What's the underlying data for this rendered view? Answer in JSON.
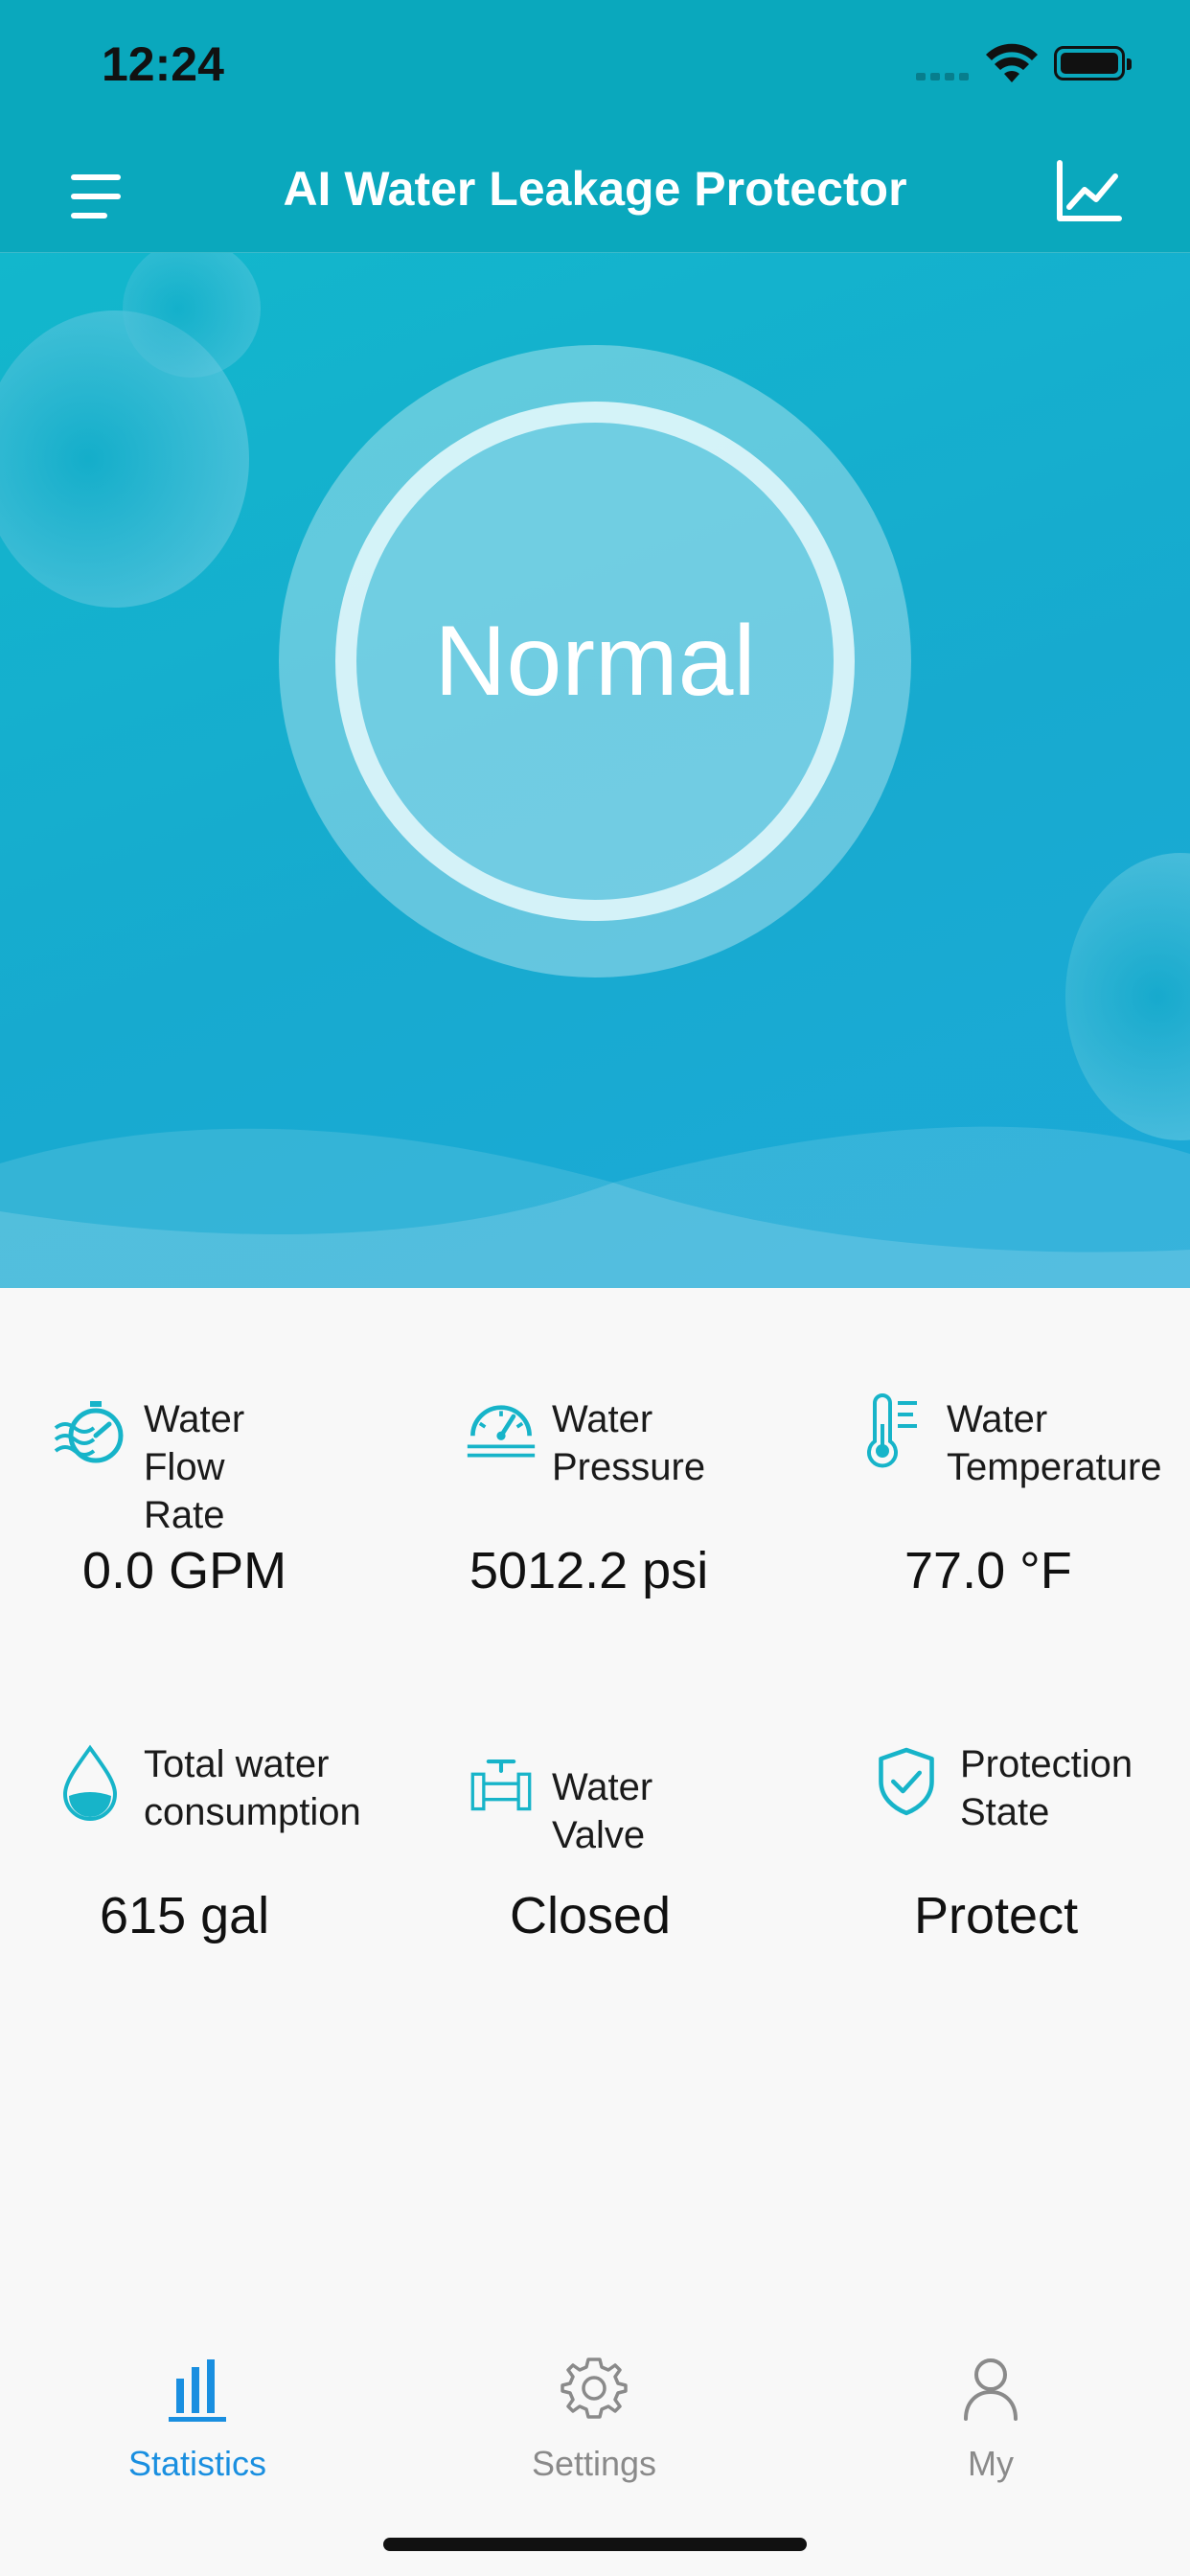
{
  "status_bar": {
    "time": "12:24"
  },
  "nav": {
    "title": "AI Water Leakage Protector",
    "menu_icon": "hamburger-menu-icon",
    "chart_icon": "line-chart-icon"
  },
  "hero": {
    "status": "Normal"
  },
  "stats": [
    {
      "label": "Water\nFlow Rate",
      "value": "0.0 GPM",
      "icon": "flow-rate-icon"
    },
    {
      "label": "Water\nPressure",
      "value": "5012.2 psi",
      "icon": "pressure-gauge-icon"
    },
    {
      "label": "Water\nTemperature",
      "value": "77.0 °F",
      "icon": "thermometer-icon"
    },
    {
      "label": "Total water\nconsumption",
      "value": "615 gal",
      "icon": "water-drop-icon"
    },
    {
      "label": "Water Valve",
      "value": "Closed",
      "icon": "valve-icon"
    },
    {
      "label": "Protection\nState",
      "value": "Protect",
      "icon": "shield-check-icon"
    }
  ],
  "tabs": [
    {
      "label": "Statistics",
      "icon": "statistics-icon",
      "active": true
    },
    {
      "label": "Settings",
      "icon": "gear-icon",
      "active": false
    },
    {
      "label": "My",
      "icon": "person-icon",
      "active": false
    }
  ],
  "colors": {
    "primary": "#0aa8bd",
    "tab_active": "#1a8fe0",
    "tab_inactive": "#8a8a8a",
    "icon_teal": "#17b4c9"
  }
}
